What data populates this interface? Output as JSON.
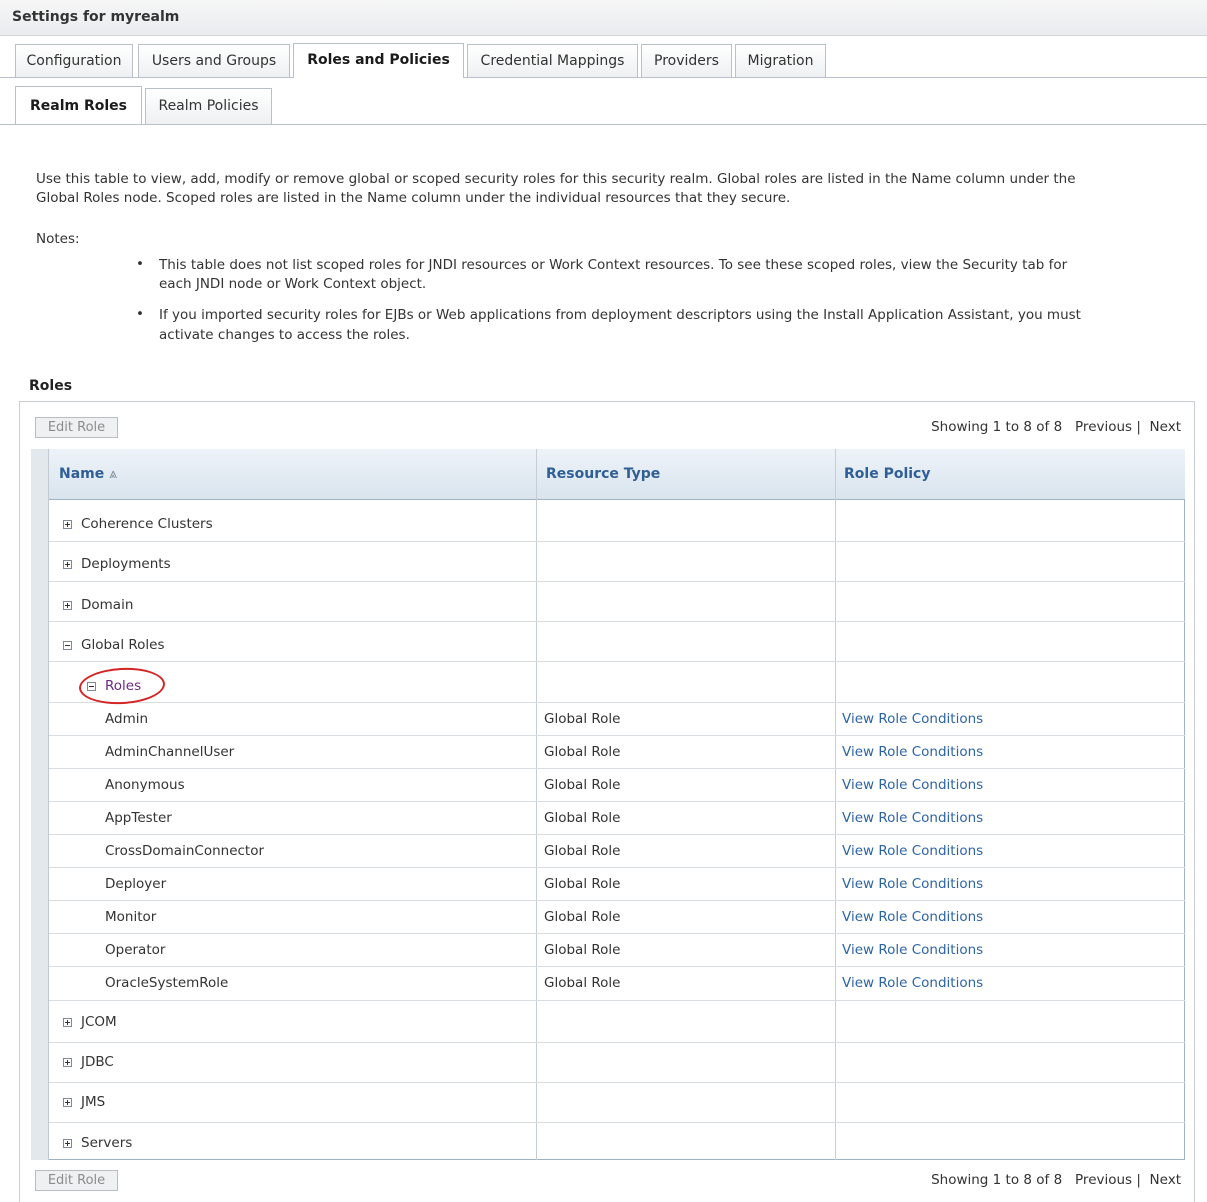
{
  "page": {
    "title": "Settings for myrealm"
  },
  "tabs": [
    "Configuration",
    "Users and Groups",
    "Roles and Policies",
    "Credential Mappings",
    "Providers",
    "Migration"
  ],
  "active_tab": "Roles and Policies",
  "subtabs": [
    "Realm Roles",
    "Realm Policies"
  ],
  "active_subtab": "Realm Roles",
  "description": {
    "line1": "Use this table to view, add, modify or remove global or scoped security roles for this security realm. Global roles are listed in the Name column under the",
    "line2": "Global Roles node. Scoped roles are listed in the Name column under the individual resources that they secure.",
    "notes_label": "Notes:",
    "note1_line1": "This table does not list scoped roles for JNDI resources or Work Context resources. To see these scoped roles, view the Security tab for",
    "note1_line2": "each JNDI node or Work Context object.",
    "note2_line1": "If you imported security roles for EJBs or Web applications from deployment descriptors using the Install Application Assistant, you must",
    "note2_line2": "activate changes to access the roles.",
    "bullet": "•"
  },
  "roles_section": {
    "title": "Roles",
    "edit_button": "Edit Role",
    "pager": {
      "showing": "Showing 1 to 8 of 8",
      "previous": "Previous",
      "separator": "|",
      "next": "Next"
    }
  },
  "table": {
    "headers": {
      "name": "Name",
      "sort_glyph": "⩓",
      "resource_type": "Resource Type",
      "role_policy": "Role Policy"
    },
    "tree_nodes": {
      "coherence": "Coherence Clusters",
      "deployments": "Deployments",
      "domain": "Domain",
      "global_roles": "Global Roles",
      "roles": "Roles",
      "jcom": "JCOM",
      "jdbc": "JDBC",
      "jms": "JMS",
      "servers": "Servers"
    },
    "role_rows": [
      {
        "name": "Admin",
        "type": "Global Role",
        "policy": "View Role Conditions"
      },
      {
        "name": "AdminChannelUser",
        "type": "Global Role",
        "policy": "View Role Conditions"
      },
      {
        "name": "Anonymous",
        "type": "Global Role",
        "policy": "View Role Conditions"
      },
      {
        "name": "AppTester",
        "type": "Global Role",
        "policy": "View Role Conditions"
      },
      {
        "name": "CrossDomainConnector",
        "type": "Global Role",
        "policy": "View Role Conditions"
      },
      {
        "name": "Deployer",
        "type": "Global Role",
        "policy": "View Role Conditions"
      },
      {
        "name": "Monitor",
        "type": "Global Role",
        "policy": "View Role Conditions"
      },
      {
        "name": "Operator",
        "type": "Global Role",
        "policy": "View Role Conditions"
      },
      {
        "name": "OracleSystemRole",
        "type": "Global Role",
        "policy": "View Role Conditions"
      }
    ]
  },
  "colors": {
    "link": "#2d64a6",
    "header_text": "#2f5f96",
    "visited_link": "#6b2a7d",
    "highlight": "#d42424"
  }
}
